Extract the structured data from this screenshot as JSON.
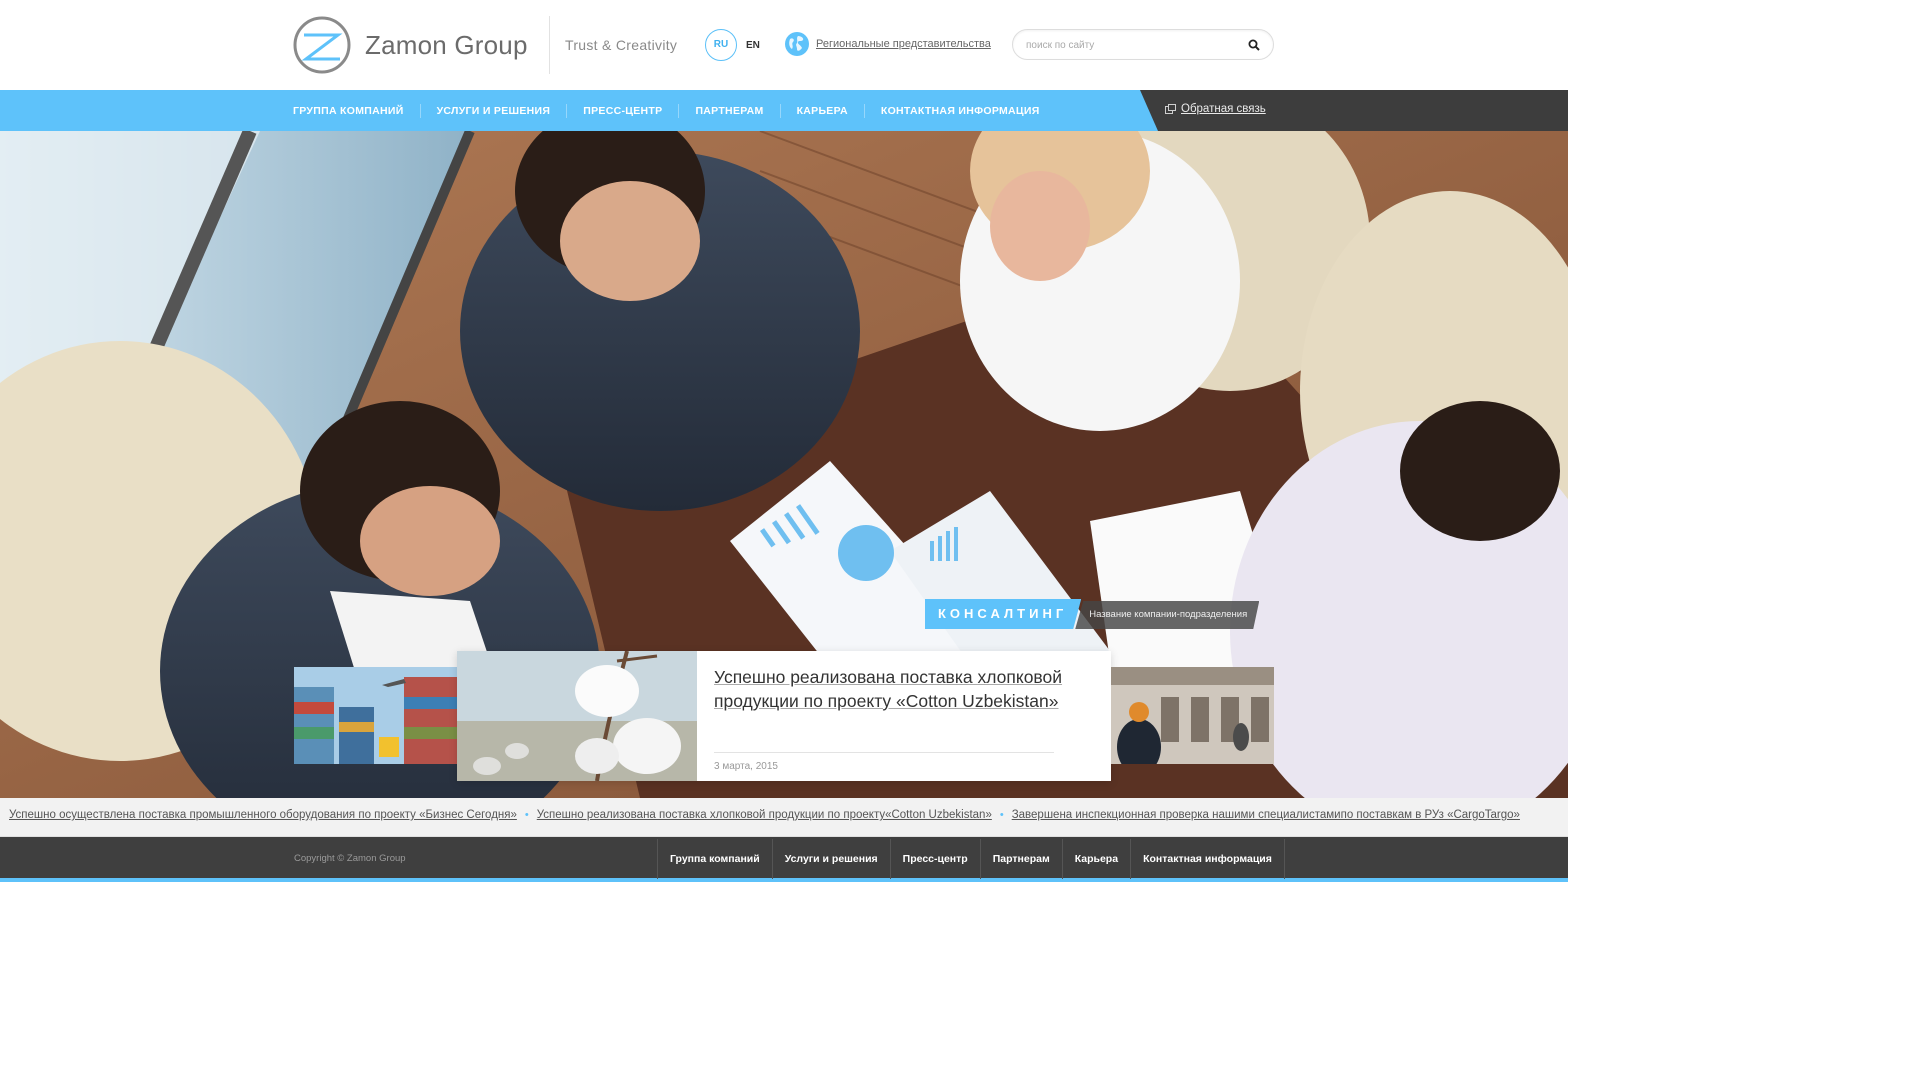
{
  "header": {
    "brand": "Zamon Group",
    "tagline": "Trust & Creativity",
    "lang_ru": "RU",
    "lang_en": "EN",
    "regional_link": "Региональные представительства",
    "search_placeholder": "поиск по сайту"
  },
  "nav": {
    "items": [
      {
        "label": "Группа компаний"
      },
      {
        "label": "Услуги и решения"
      },
      {
        "label": "Пресс-центр"
      },
      {
        "label": "Партнерам"
      },
      {
        "label": "Карьера"
      },
      {
        "label": "Контактная информация"
      }
    ],
    "feedback": "Обратная связь"
  },
  "hero": {
    "category": "КОНСАЛТИНГ",
    "subsidiary": "Название компании-подразделения"
  },
  "slider": {
    "active_title": "Успешно реализована поставка хлопковой продукции по проекту «Cotton Uzbekistan»",
    "active_date": "3 марта, 2015"
  },
  "ticker": {
    "items": [
      "Успешно осуществлена поставка промышленного оборудования по проекту «Бизнес Сегодня»",
      "Успешно реализована поставка хлопковой продукции по проекту«Cotton Uzbekistan»",
      "Завершена инспекционная проверка нашими специалистамипо поставкам в РУз «CargoTargo»"
    ]
  },
  "footer": {
    "copyright": "Copyright © Zamon Group",
    "items": [
      {
        "label": "Группа компаний"
      },
      {
        "label": "Услуги и решения"
      },
      {
        "label": "Пресс-центр"
      },
      {
        "label": "Партнерам"
      },
      {
        "label": "Карьера"
      },
      {
        "label": "Контактная информация"
      }
    ]
  },
  "colors": {
    "accent": "#5ec2fa",
    "dark": "#3f3f3f"
  }
}
